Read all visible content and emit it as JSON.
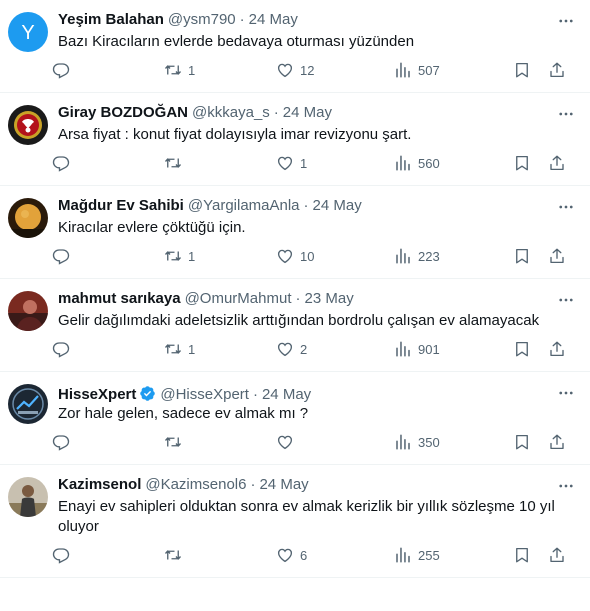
{
  "tweets": [
    {
      "name": "Yeşim Balahan",
      "handle": "@ysm790",
      "date": "24 May",
      "text": "Bazı Kiracıların evlerde bedavaya oturması yüzünden",
      "replies": "",
      "retweets": "1",
      "likes": "12",
      "views": "507",
      "avatar": {
        "type": "letter",
        "letter": "Y",
        "color": "#1d9bf0"
      },
      "verified": false
    },
    {
      "name": "Giray BOZDOĞAN",
      "handle": "@kkkaya_s",
      "date": "24 May",
      "text": "Arsa fiyat : konut fiyat dolayısıyla imar revizyonu şart.",
      "replies": "",
      "retweets": "",
      "likes": "1",
      "views": "560",
      "avatar": {
        "type": "emblem",
        "color": "#1a1a1a"
      },
      "verified": false
    },
    {
      "name": "Mağdur Ev Sahibi",
      "handle": "@YargilamaAnla",
      "date": "24 May",
      "text": "Kiracılar evlere çöktüğü için.",
      "replies": "",
      "retweets": "1",
      "likes": "10",
      "views": "223",
      "avatar": {
        "type": "moon",
        "color": "#2a1a0a"
      },
      "verified": false
    },
    {
      "name": "mahmut sarıkaya",
      "handle": "@OmurMahmut",
      "date": "23 May",
      "text": "Gelir dağılımdaki adeletsizlik arttığından bordrolu çalışan ev alamayacak",
      "replies": "",
      "retweets": "1",
      "likes": "2",
      "views": "901",
      "avatar": {
        "type": "photo-red",
        "color": "#7a2a20"
      },
      "verified": false
    },
    {
      "name": "HisseXpert",
      "handle": "@HisseXpert",
      "date": "24 May",
      "text": "Zor hale gelen, sadece ev almak mı ?",
      "replies": "",
      "retweets": "",
      "likes": "",
      "views": "350",
      "avatar": {
        "type": "logo",
        "color": "#1c2733"
      },
      "verified": true
    },
    {
      "name": "Kazimsenol",
      "handle": "@Kazimsenol6",
      "date": "24 May",
      "text": "Enayi ev sahipleri olduktan sonra ev almak kerizlik bir yıllık sözleşme 10 yıl oluyor",
      "replies": "",
      "retweets": "",
      "likes": "6",
      "views": "255",
      "avatar": {
        "type": "photo-person",
        "color": "#c8c0b0"
      },
      "verified": false
    }
  ],
  "colors": {
    "text": "#0f1419",
    "secondary": "#536471",
    "divider": "#eff3f4",
    "verified": "#1d9bf0"
  },
  "icons": [
    "reply-icon",
    "retweet-icon",
    "like-icon",
    "views-icon",
    "bookmark-icon",
    "share-icon",
    "more-icon",
    "verified-badge-icon"
  ]
}
